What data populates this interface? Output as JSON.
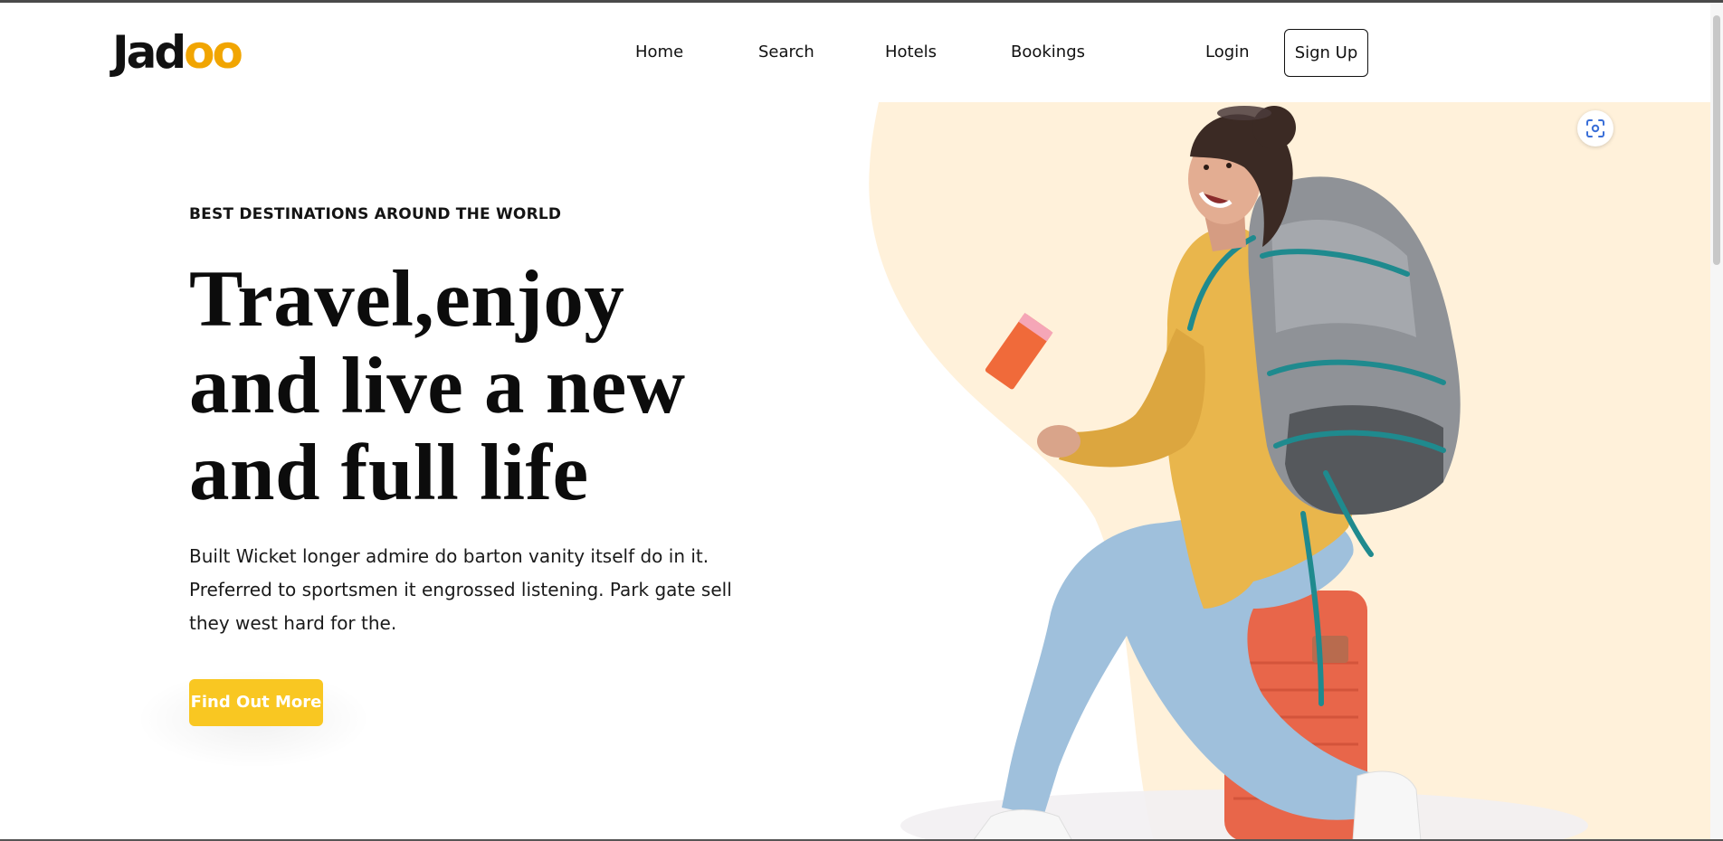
{
  "brand": {
    "name_main": "Jad",
    "name_accent": "oo"
  },
  "nav": {
    "items": [
      "Home",
      "Search",
      "Hotels",
      "Bookings"
    ],
    "login_label": "Login",
    "signup_label": "Sign Up"
  },
  "hero": {
    "eyebrow": "BEST DESTINATIONS AROUND THE WORLD",
    "headline_lines": [
      "Travel,enjoy",
      "and live a new",
      "and full life"
    ],
    "description_lines": [
      "Built Wicket longer admire do barton vanity itself do in it.",
      "Preferred to sportsmen it engrossed listening. Park gate sell",
      "they west hard for the."
    ],
    "cta_label": "Find Out More"
  },
  "icons": {
    "scan": "scan-icon",
    "hero_image": "traveler-with-backpack-illustration"
  },
  "colors": {
    "accent": "#f1a501",
    "cta": "#f9c722",
    "hero_blob": "#fff1da",
    "text": "#111111"
  }
}
